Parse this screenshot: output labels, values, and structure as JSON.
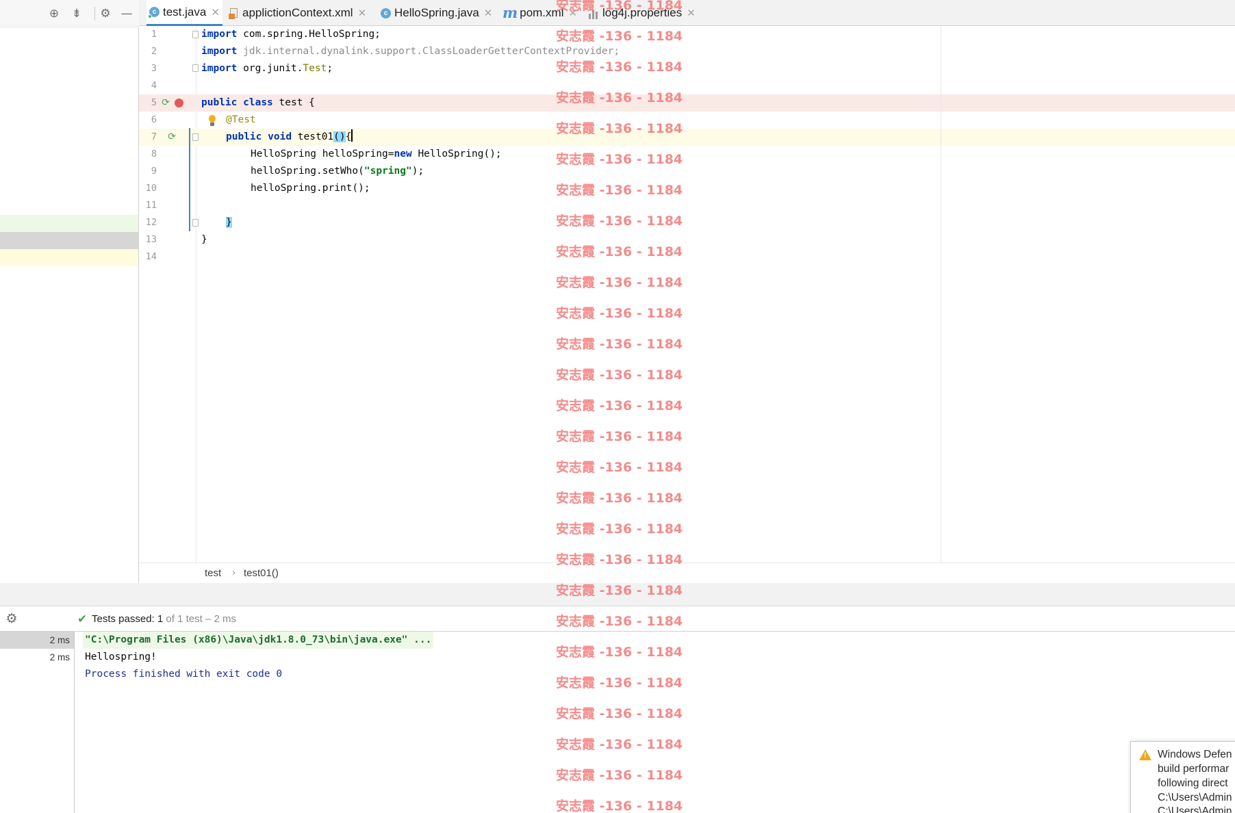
{
  "tabs": [
    {
      "label": "test.java",
      "icon": "java-class-icon",
      "active": true
    },
    {
      "label": "applictionContext.xml",
      "icon": "xml-file-icon",
      "active": false
    },
    {
      "label": "HelloSpring.java",
      "icon": "java-class-icon",
      "active": false
    },
    {
      "label": "pom.xml",
      "icon": "maven-icon",
      "active": false
    },
    {
      "label": "log4j.properties",
      "icon": "properties-file-icon",
      "active": false
    }
  ],
  "left_toolbar": {
    "icons": [
      "locate-icon",
      "collapse-all-icon",
      "settings-icon",
      "minimize-icon"
    ]
  },
  "editor": {
    "line_numbers": [
      "1",
      "2",
      "3",
      "4",
      "5",
      "6",
      "7",
      "8",
      "9",
      "10",
      "11",
      "12",
      "13",
      "14"
    ],
    "lines": {
      "l1_kw": "import",
      "l1_rest": " com.spring.HelloSpring;",
      "l2_kw": "import",
      "l2_rest": " jdk.internal.dynalink.support.ClassLoaderGetterContextProvider;",
      "l3_kw": "import",
      "l3_pkg": " org.junit.",
      "l3_cls": "Test",
      "l3_end": ";",
      "l5_kw1": "public",
      "l5_kw2": "class",
      "l5_rest": " test {",
      "l6_ann": "@Test",
      "l7_kw1": "public",
      "l7_kw2": "void",
      "l7_name": " test01",
      "l7_paren": "()",
      "l7_brace": "{",
      "l8_a": "HelloSpring helloSpring=",
      "l8_kw": "new",
      "l8_b": " HelloSpring();",
      "l9_a": "helloSpring.setWho(",
      "l9_str": "\"spring\"",
      "l9_b": ");",
      "l10": "helloSpring.print();",
      "l12": "}",
      "l13": "}"
    },
    "colors": {
      "keyword": "#0033b3",
      "string": "#067d17",
      "annotation": "#9e880d",
      "breakpoint_line": "#faeae6",
      "current_line": "#fefbe6"
    }
  },
  "breadcrumb": {
    "items": [
      "test",
      "test01()"
    ],
    "separator": "›"
  },
  "test_runner": {
    "status_prefix": "Tests passed: ",
    "passed": "1",
    "status_suffix": " of 1 test – 2 ms",
    "tree_times": [
      "2 ms",
      "2 ms"
    ],
    "console": [
      "\"C:\\Program Files (x86)\\Java\\jdk1.8.0_73\\bin\\java.exe\" ...",
      "Hellospring!",
      "Process finished with exit code 0"
    ]
  },
  "notification": {
    "lines": [
      "Windows Defen",
      "build performar",
      "following direct",
      "C:\\Users\\Admin",
      "C:\\Users\\Admin"
    ]
  },
  "watermark": {
    "text": "安志霞 -136 - 1184",
    "count": 27
  }
}
